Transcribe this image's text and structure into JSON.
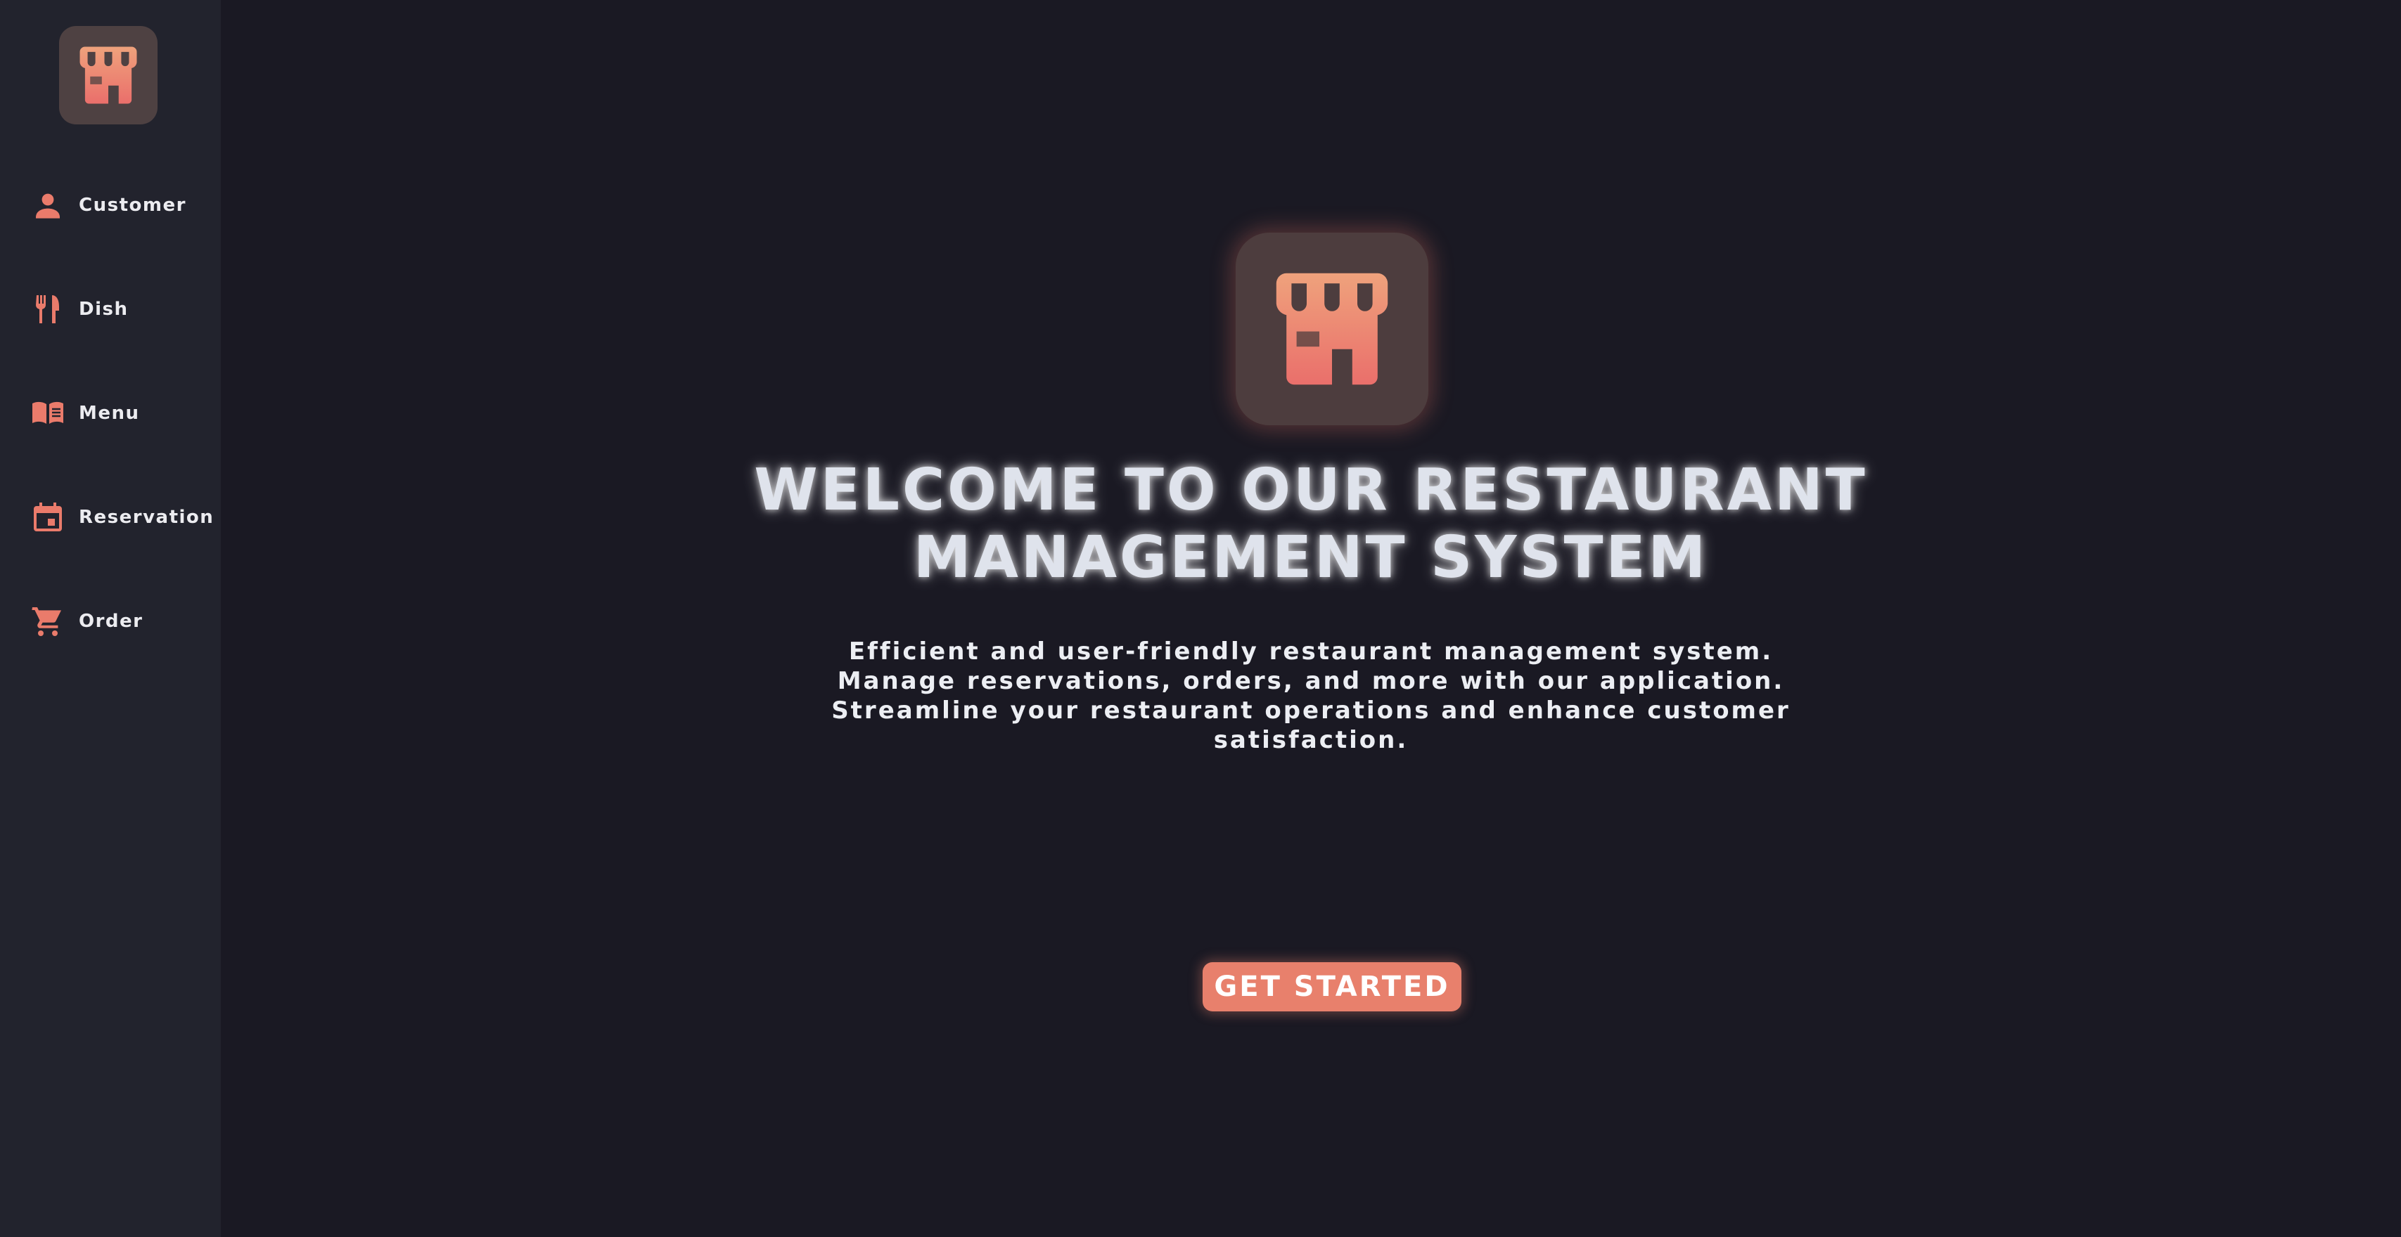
{
  "app": {
    "logo_icon": "storefront-icon",
    "accent_color": "#e8806c"
  },
  "sidebar": {
    "items": [
      {
        "label": "Customer",
        "icon": "person-icon"
      },
      {
        "label": "Dish",
        "icon": "fork-knife-icon"
      },
      {
        "label": "Menu",
        "icon": "menu-book-icon"
      },
      {
        "label": "Reservation",
        "icon": "calendar-icon"
      },
      {
        "label": "Order",
        "icon": "shopping-cart-icon"
      }
    ]
  },
  "hero": {
    "title_line1": "WELCOME TO OUR RESTAURANT",
    "title_line2": "MANAGEMENT SYSTEM",
    "description_lines": [
      "Efficient and user-friendly restaurant management system.",
      "Manage reservations, orders, and more with our application.",
      "Streamline your restaurant operations and enhance customer",
      "satisfaction."
    ],
    "cta_label": "GET STARTED"
  }
}
